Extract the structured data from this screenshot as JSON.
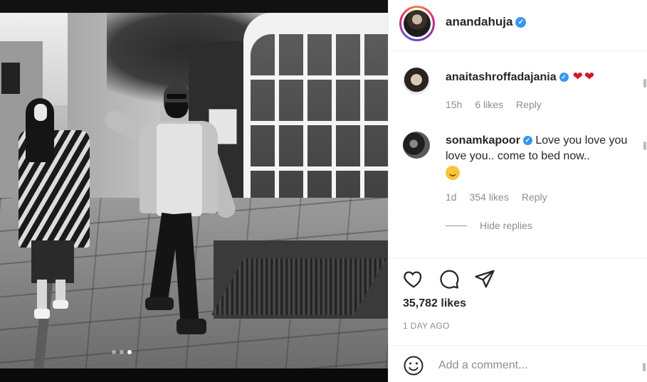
{
  "post": {
    "author": "anandahuja",
    "author_verified": true,
    "carousel": {
      "total": 3,
      "active_index": 1
    }
  },
  "comments": [
    {
      "username": "anaitashroffadajania",
      "verified": true,
      "text": "",
      "emoji": "❤❤",
      "time": "15h",
      "likes": "6 likes",
      "reply": "Reply"
    },
    {
      "username": "sonamkapoor",
      "verified": true,
      "text": "Love you love you love you.. come to bed now..",
      "emoji": "hugging-face",
      "time": "1d",
      "likes": "354 likes",
      "reply": "Reply"
    }
  ],
  "hide_replies": "Hide replies",
  "actions": {
    "like": "heart-icon",
    "comment": "comment-icon",
    "share": "share-icon"
  },
  "like_count": "35,782 likes",
  "timestamp": "1 DAY AGO",
  "add_comment": {
    "placeholder": "Add a comment..."
  },
  "colors": {
    "verified": "#3897f0",
    "heart": "#d9142b",
    "muted": "#8e8e8e",
    "text": "#262626"
  }
}
